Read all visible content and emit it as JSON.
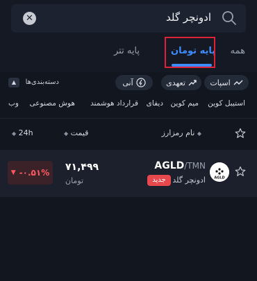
{
  "search": {
    "query": "ادونچر گلد"
  },
  "tabs": [
    {
      "label": "همه"
    },
    {
      "label": "پایه تومان"
    },
    {
      "label": "پایه تتر"
    }
  ],
  "chips": [
    {
      "label": "اسپات"
    },
    {
      "label": "تعهدی"
    },
    {
      "label": "آنی"
    }
  ],
  "categories_label": "دسته‌بندی‌ها",
  "categories": [
    "استیبل کوین",
    "میم کوین",
    "دیفای",
    "قرارداد هوشمند",
    "هوش مصنوعی",
    "وب"
  ],
  "table": {
    "col_name": "نام رمزارز",
    "col_price": "قیمت",
    "col_change": "24h"
  },
  "row": {
    "symbol": "AGLD",
    "quote": "/TMN",
    "name_fa": "ادونچر گلد",
    "badge": "جدید",
    "logo_text": "AGLD",
    "price": "۷۱,۴۹۹",
    "unit": "تومان",
    "change": "-۰.۵۱%"
  },
  "colors": {
    "accent": "#3f8cff",
    "negative": "#ff5a62",
    "highlight_box": "#e0213a",
    "badge": "#e5484d"
  }
}
